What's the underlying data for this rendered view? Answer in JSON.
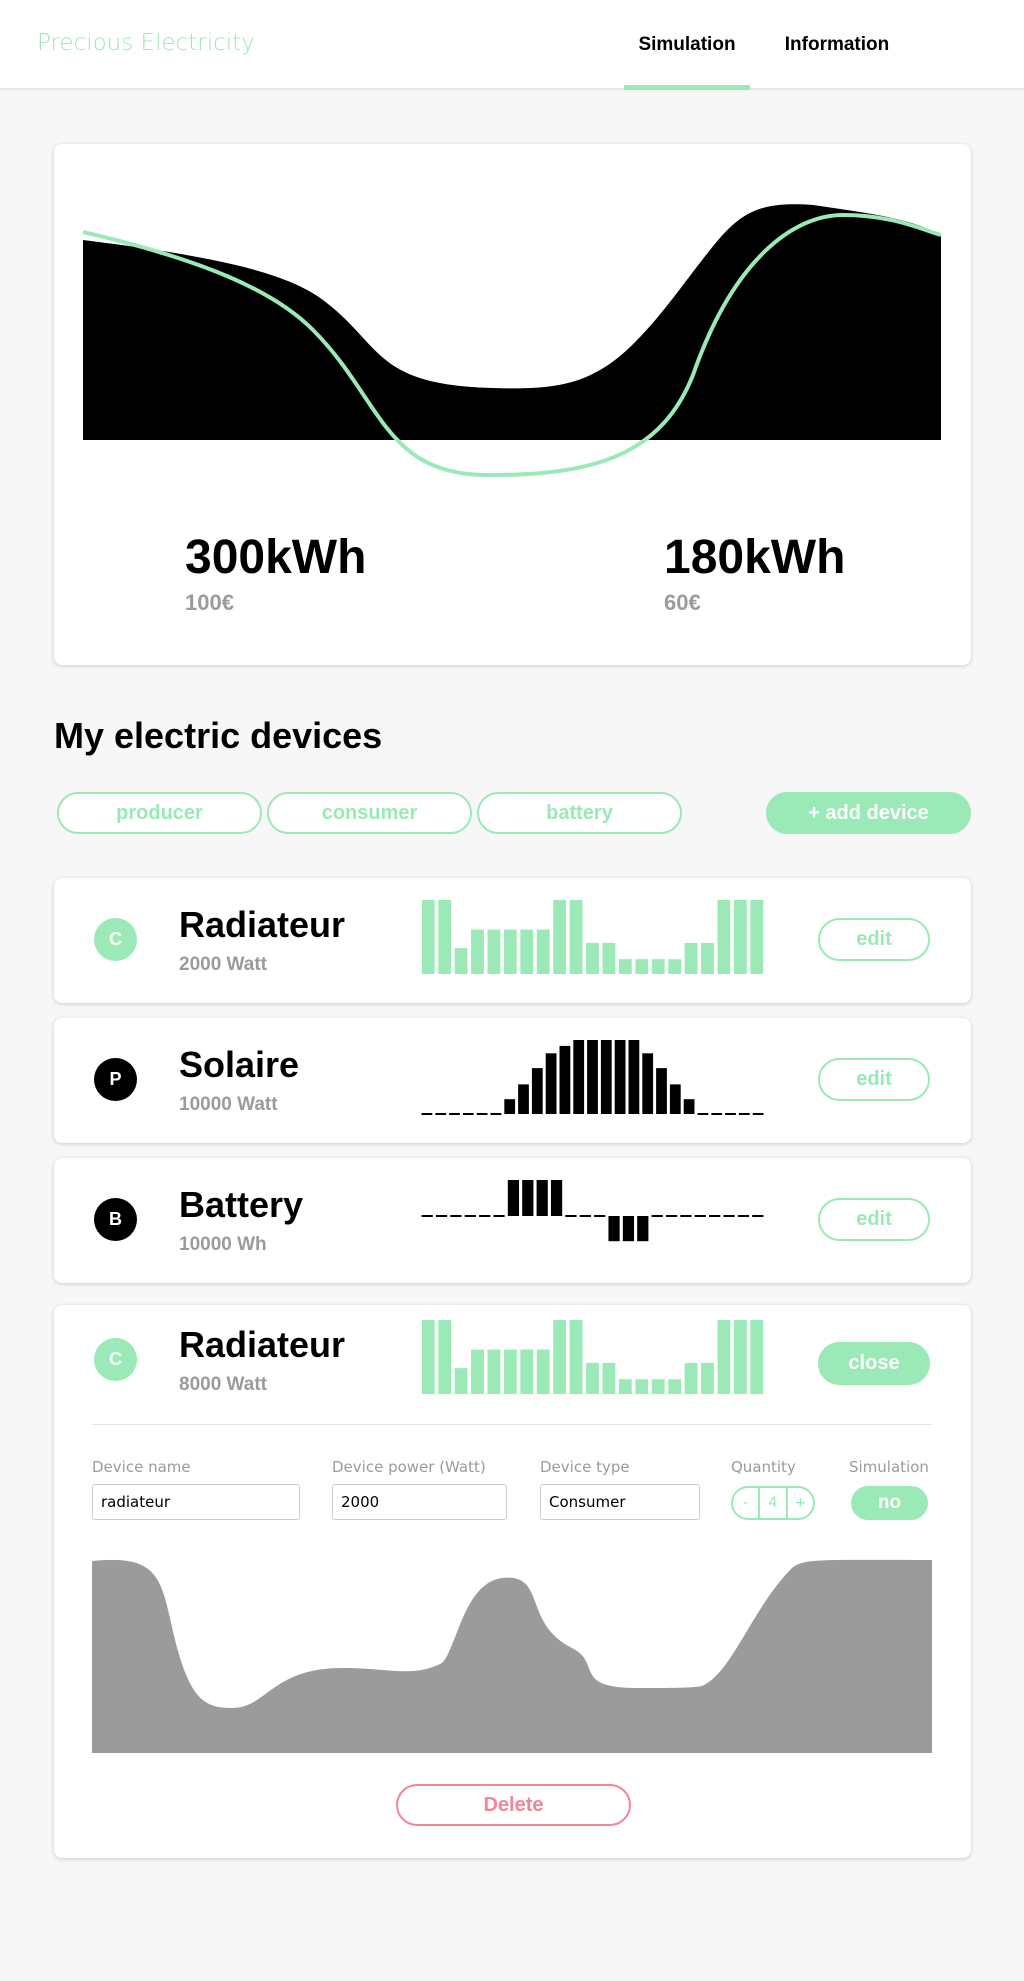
{
  "app": {
    "brand": "Precious Electricity"
  },
  "nav": {
    "tabs": [
      {
        "label": "Simulation",
        "active": true
      },
      {
        "label": "Information",
        "active": false
      }
    ]
  },
  "summary": {
    "stats": [
      {
        "energy": "300kWh",
        "price": "100€"
      },
      {
        "energy": "180kWh",
        "price": "60€"
      }
    ]
  },
  "devices_section": {
    "title": "My electric devices",
    "filters": [
      {
        "label": "producer"
      },
      {
        "label": "consumer"
      },
      {
        "label": "battery"
      }
    ],
    "add_label": "+ add device"
  },
  "devices": [
    {
      "badge": "C",
      "name": "Radiateur",
      "power": "2000 Watt",
      "action": "edit",
      "profile": [
        1,
        1,
        0.35,
        0.6,
        0.6,
        0.6,
        0.6,
        0.6,
        1,
        1,
        0.42,
        0.42,
        0.2,
        0.2,
        0.2,
        0.2,
        0.42,
        0.42,
        1,
        1,
        1
      ]
    },
    {
      "badge": "P",
      "name": "Solaire",
      "power": "10000 Watt",
      "action": "edit",
      "profile": [
        0,
        0,
        0,
        0,
        0,
        0,
        0.2,
        0.4,
        0.62,
        0.82,
        0.92,
        1,
        1,
        1,
        1,
        1,
        0.82,
        0.62,
        0.4,
        0.2,
        0,
        0,
        0,
        0,
        0
      ]
    },
    {
      "badge": "B",
      "name": "Battery",
      "power": "10000 Wh",
      "action": "edit",
      "profile": [
        0,
        0,
        0,
        0,
        0,
        0,
        1,
        1,
        1,
        1,
        0,
        0,
        0,
        -0.7,
        -0.7,
        -0.7,
        0,
        0,
        0,
        0,
        0,
        0,
        0,
        0
      ]
    },
    {
      "badge": "C",
      "name": "Radiateur",
      "power": "8000 Watt",
      "action": "close",
      "profile": [
        1,
        1,
        0.35,
        0.6,
        0.6,
        0.6,
        0.6,
        0.6,
        1,
        1,
        0.42,
        0.42,
        0.2,
        0.2,
        0.2,
        0.2,
        0.42,
        0.42,
        1,
        1,
        1
      ]
    }
  ],
  "editor": {
    "name_label": "Device name",
    "name_value": "radiateur",
    "power_label": "Device power (Watt)",
    "power_value": "2000",
    "type_label": "Device type",
    "type_value": "Consumer",
    "quantity_label": "Quantity",
    "quantity_minus": "-",
    "quantity_value": "4",
    "quantity_plus": "+",
    "simulation_label": "Simulation",
    "simulation_value": "no",
    "delete_label": "Delete"
  },
  "colors": {
    "accent": "#9ae9b6",
    "danger": "#f28597",
    "muted": "#9b9b9b",
    "dark": "#000000",
    "profile_area": "#9b9b9b"
  },
  "icons": {
    "badge_shape": "circle"
  }
}
